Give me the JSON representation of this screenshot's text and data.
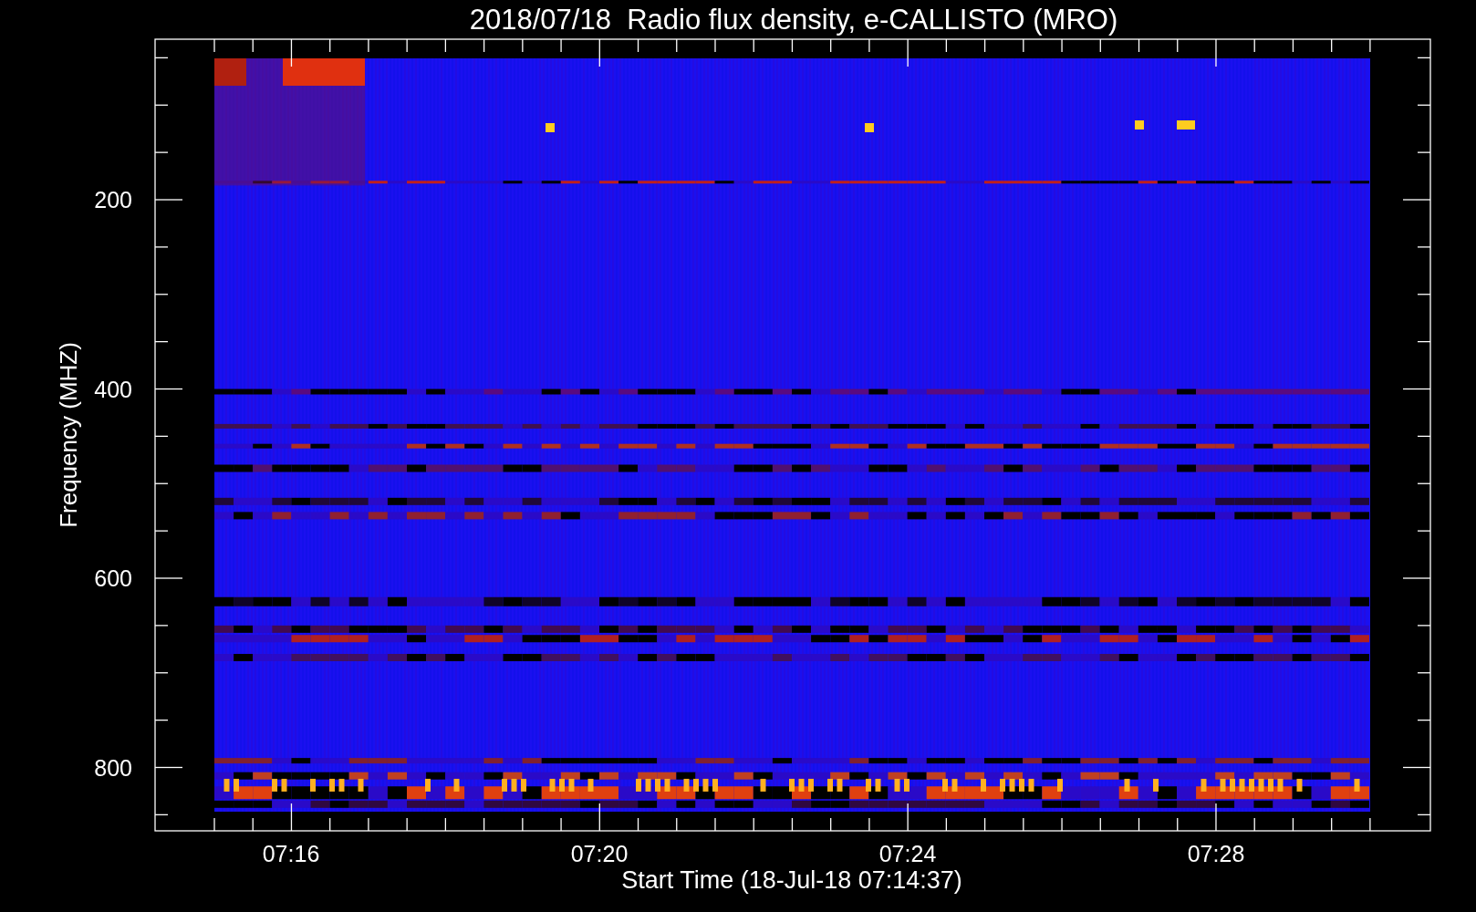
{
  "title": "2018/07/18  Radio flux density, e-CALLISTO (MRO)",
  "y_axis": {
    "label": "Frequency (MHZ)",
    "ticks": [
      "200",
      "400",
      "600",
      "800"
    ]
  },
  "x_axis": {
    "label": "Start Time (18-Jul-18 07:14:37)",
    "ticks": [
      "07:16",
      "07:20",
      "07:24",
      "07:28"
    ]
  }
}
